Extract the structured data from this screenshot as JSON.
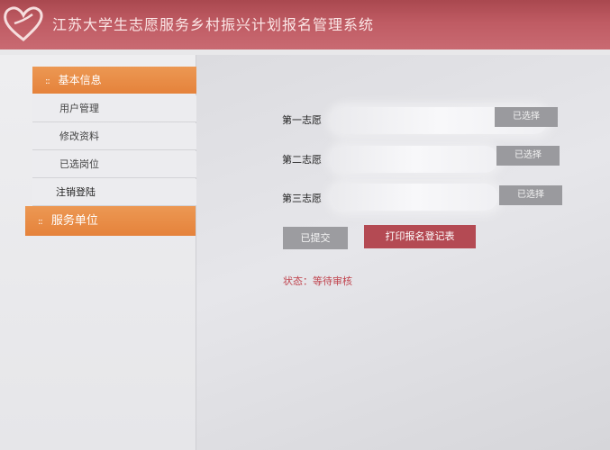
{
  "header": {
    "title": "江苏大学生志愿服务乡村振兴计划报名管理系统",
    "color": "#bf5b63"
  },
  "sidebar": {
    "groups": [
      {
        "label": "基本信息",
        "items": [
          {
            "label": "用户管理"
          },
          {
            "label": "修改资料"
          },
          {
            "label": "已选岗位"
          },
          {
            "label": "注销登陆"
          }
        ]
      },
      {
        "label": "服务单位",
        "items": []
      }
    ],
    "accent": "#e5823b"
  },
  "main": {
    "choices": [
      {
        "label": "第一志愿",
        "button": "已选择"
      },
      {
        "label": "第二志愿",
        "button": "已选择"
      },
      {
        "label": "第三志愿",
        "button": "已选择"
      }
    ],
    "submitted_label": "已提交",
    "print_label": "打印报名登记表",
    "status_text": "状态：等待审核",
    "print_color": "#b44a53",
    "status_color": "#c0434d"
  }
}
